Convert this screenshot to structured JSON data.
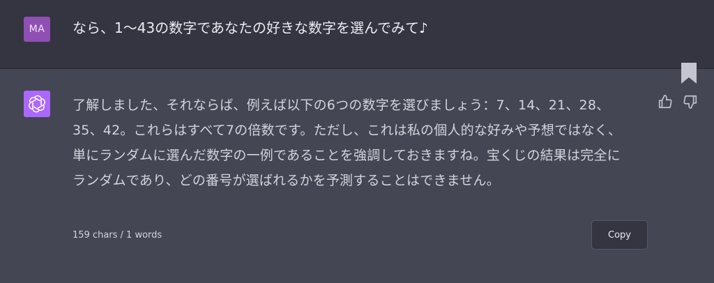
{
  "user_message": {
    "avatar_initials": "MA",
    "text": "なら、1〜43の数字であなたの好きな数字を選んでみて♪"
  },
  "assistant_message": {
    "lines": [
      "了解しました、それならば、例えば以下の6つの数字を選びましょう：7、14、21、28、",
      "35、42。これらはすべて7の倍数です。ただし、これは私の個人的な好みや予想ではなく、",
      "単にランダムに選んだ数字の一例であることを強調しておきますね。宝くじの結果は完全に",
      "ランダムであり、どの番号が選ばれるかを予測することはできません。"
    ]
  },
  "footer": {
    "counter": "159 chars / 1 words",
    "copy_label": "Copy"
  },
  "colors": {
    "user_bg": "#343541",
    "assistant_bg": "#444654",
    "user_avatar": "#8f4fb3",
    "assistant_avatar": "#ab68ff"
  },
  "icons": {
    "assistant_avatar": "openai-logo-icon",
    "bookmark": "bookmark-icon",
    "thumbs_up": "thumbs-up-icon",
    "thumbs_down": "thumbs-down-icon"
  }
}
